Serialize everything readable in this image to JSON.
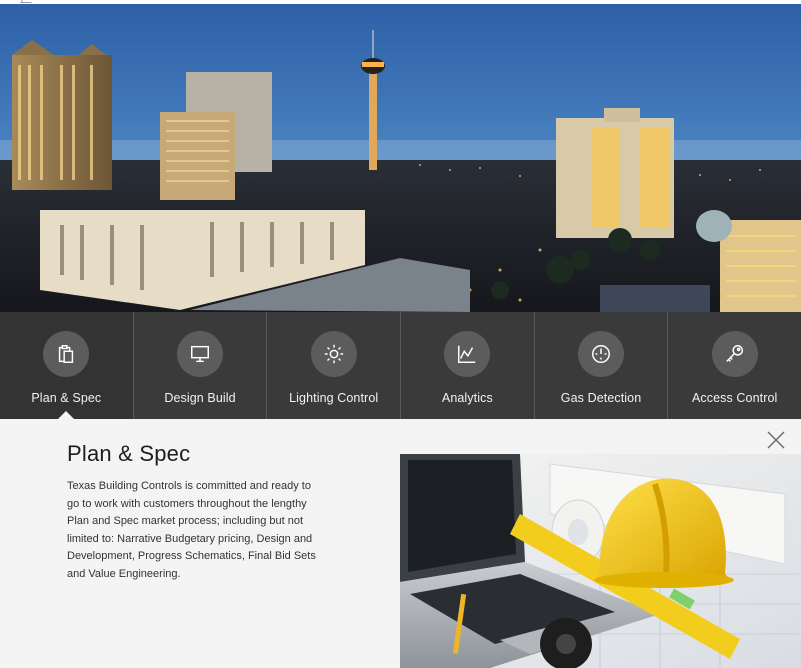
{
  "services": [
    {
      "label": "Plan & Spec",
      "icon": "clipboard-icon",
      "active": true
    },
    {
      "label": "Design Build",
      "icon": "monitor-icon",
      "active": false
    },
    {
      "label": "Lighting Control",
      "icon": "sun-icon",
      "active": false
    },
    {
      "label": "Analytics",
      "icon": "line-chart-icon",
      "active": false
    },
    {
      "label": "Gas Detection",
      "icon": "gauge-icon",
      "active": false
    },
    {
      "label": "Access Control",
      "icon": "key-icon",
      "active": false
    }
  ],
  "detail": {
    "title": "Plan & Spec",
    "body": "Texas Building Controls is committed and ready to go to work with customers throughout the lengthy Plan and Spec market process; including but not limited to: Narrative Budgetary pricing, Design and Development, Progress Schematics, Final Bid Sets and Value Engineering.",
    "close_icon": "close-icon"
  },
  "colors": {
    "service_bar": "#3a3a3a",
    "icon_circle": "#5c5c5c",
    "panel_bg": "#f5f4f4",
    "hardhat": "#f6c400"
  }
}
